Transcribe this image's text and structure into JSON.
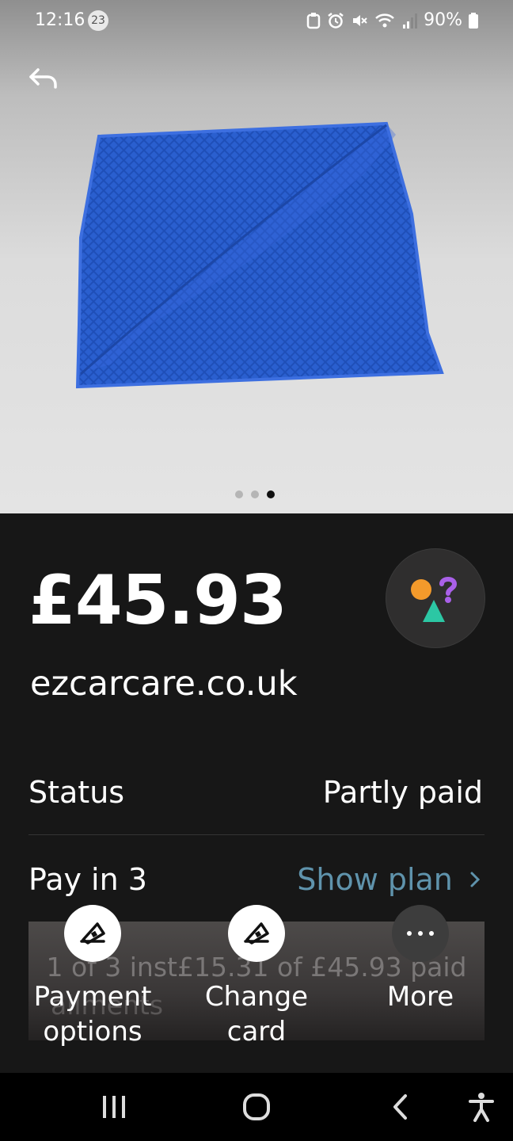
{
  "status_bar": {
    "time": "12:16",
    "notification_count": "23",
    "battery": "90%",
    "icons": [
      "backup-icon",
      "alarm-icon",
      "mute-icon",
      "wifi-icon",
      "signal-icon",
      "battery-icon"
    ]
  },
  "gallery": {
    "image": "blue-microfiber-cloth",
    "page_count": 3,
    "active_page": 3
  },
  "payment": {
    "amount": "£45.93",
    "merchant": "ezcarcare.co.uk"
  },
  "details": {
    "status_label": "Status",
    "status_value": "Partly paid",
    "plan_label": "Pay in 3",
    "show_plan": "Show plan",
    "plan_progress_line1": "1 of 3 inst£15.31 of £45.93 paid",
    "plan_progress_line2": "allments"
  },
  "actions": {
    "payment_options": "Payment options",
    "change_card": "Change card",
    "more": "More"
  },
  "nav_bar": {
    "icons": [
      "recents-icon",
      "home-icon",
      "back-icon",
      "accessibility-icon"
    ]
  },
  "colors": {
    "background": "#171717",
    "accent_link": "#5f93ac",
    "logo_orange": "#f39a2b",
    "logo_purple": "#a960e8",
    "logo_teal": "#2cc7a4"
  }
}
